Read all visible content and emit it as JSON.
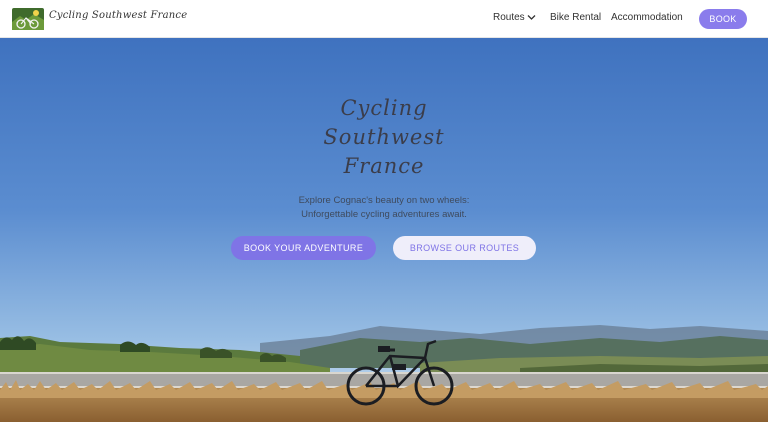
{
  "header": {
    "site_name": "Cycling Southwest France",
    "logo_icon": "cycling-logo-icon",
    "nav": {
      "routes": "Routes",
      "bike_rental": "Bike Rental",
      "accommodation": "Accommodation"
    },
    "book_label": "BOOK"
  },
  "hero": {
    "title_lines": [
      "Cycling",
      "Southwest",
      "France"
    ],
    "subtitle_lines": [
      "Explore Cognac's beauty on two wheels:",
      "Unforgettable cycling adventures await."
    ],
    "primary_cta": "BOOK YOUR ADVENTURE",
    "secondary_cta": "BROWSE OUR ROUTES"
  },
  "colors": {
    "accent": "#7f74e6",
    "sky_top": "#3f72bf",
    "sky_bottom": "#b9d4ec"
  }
}
